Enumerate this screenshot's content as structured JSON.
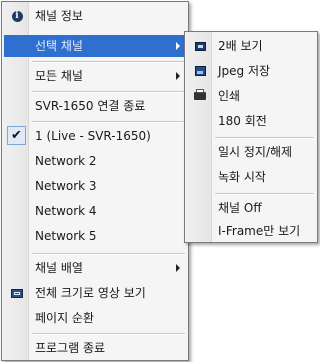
{
  "main_menu": {
    "channel_info": "채널 정보",
    "select_channel": "선택 채널",
    "all_channels": "모든 채널",
    "end_connection": "SVR-1650 연결 종료",
    "channels": [
      "1 (Live - SVR-1650)",
      "Network 2",
      "Network 3",
      "Network 4",
      "Network 5"
    ],
    "channel_layout": "채널 배열",
    "fullsize_view": "전체 크기로 영상 보기",
    "page_cycle": "페이지 순환",
    "exit_program": "프로그램 종료"
  },
  "sub_menu": {
    "zoom_2x": "2배 보기",
    "save_jpeg": "Jpeg 저장",
    "print": "인쇄",
    "rotate_180": "180 회전",
    "pause_resume": "일시 정지/해제",
    "start_recording": "녹화 시작",
    "channel_off": "채널 Off",
    "iframe_only": "I-Frame만 보기"
  },
  "colors": {
    "highlight": "#2f6fd0",
    "menu_bg": "#f5f5f5"
  },
  "icons": {
    "channel_info": "info-icon",
    "zoom_2x": "zoom-icon",
    "save_jpeg": "image-save-icon",
    "print": "printer-icon",
    "fullsize_view": "fullscreen-icon",
    "channel_checked": "checkmark-icon"
  },
  "state": {
    "checked_channel_index": 0,
    "highlighted_item": "select_channel"
  }
}
